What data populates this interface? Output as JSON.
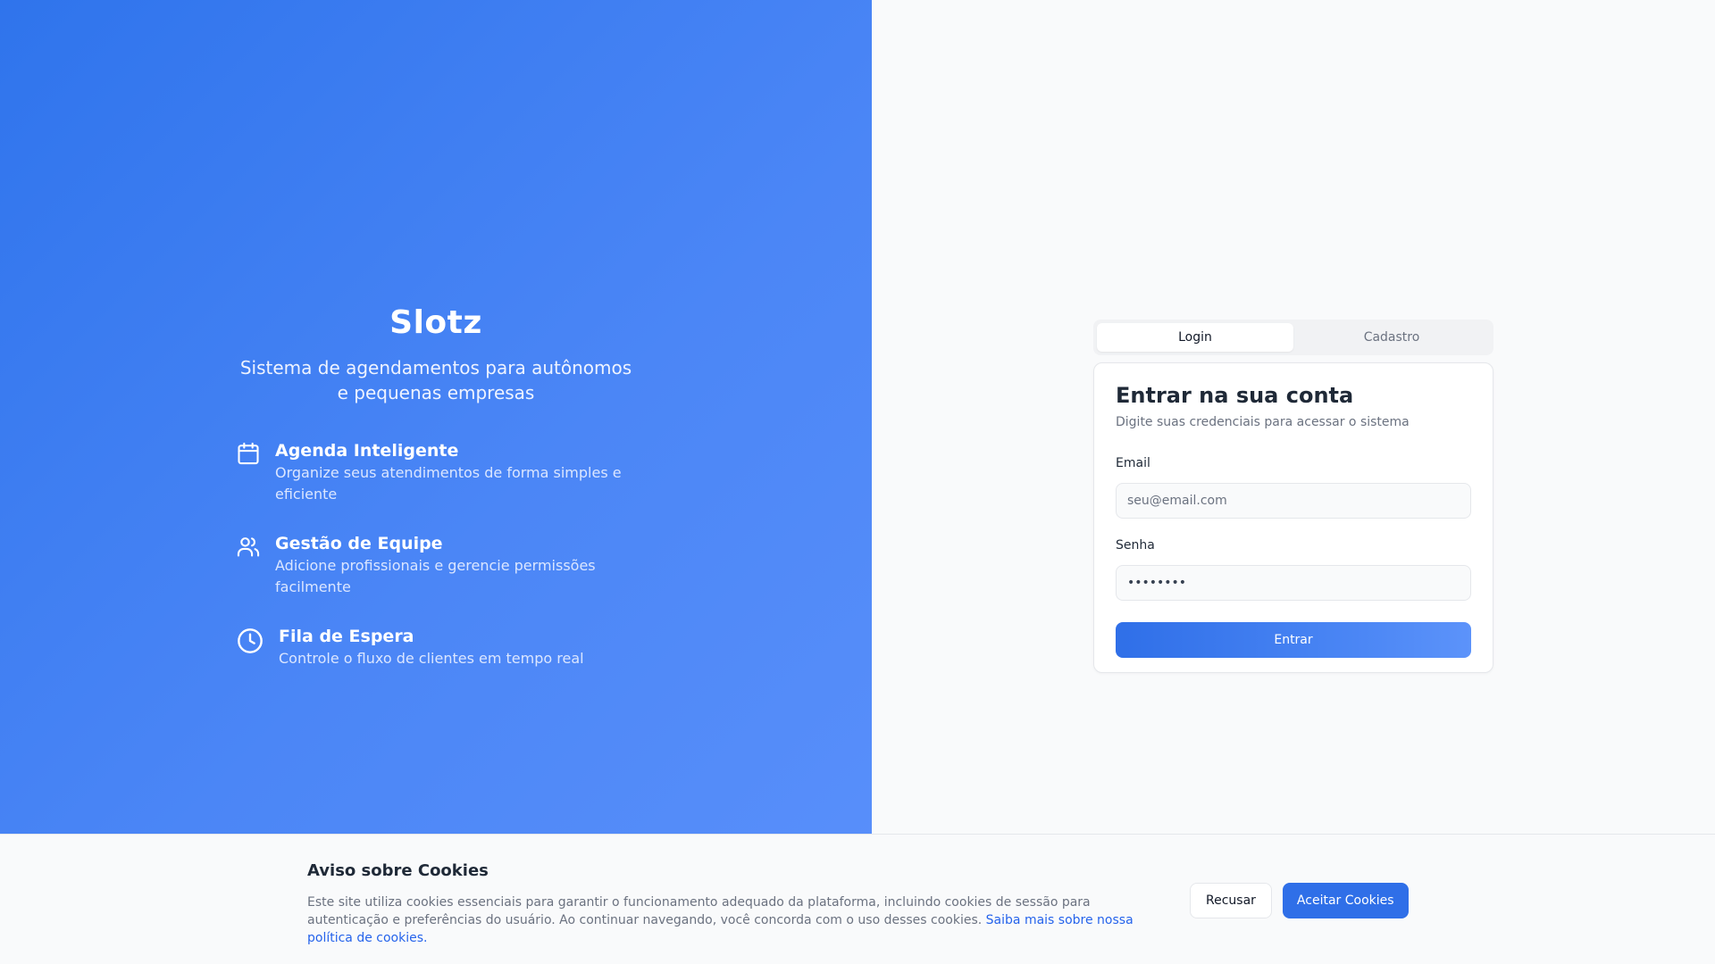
{
  "hero": {
    "brand": "Slotz",
    "tagline": "Sistema de agendamentos para autônomos e pequenas empresas",
    "features": [
      {
        "icon": "calendar-icon",
        "title": "Agenda Inteligente",
        "desc": "Organize seus atendimentos de forma simples e eficiente"
      },
      {
        "icon": "users-icon",
        "title": "Gestão de Equipe",
        "desc": "Adicione profissionais e gerencie permissões facilmente"
      },
      {
        "icon": "clock-icon",
        "title": "Fila de Espera",
        "desc": "Controle o fluxo de clientes em tempo real"
      }
    ]
  },
  "auth": {
    "tabs": [
      {
        "label": "Login",
        "active": true
      },
      {
        "label": "Cadastro",
        "active": false
      }
    ],
    "title": "Entrar na sua conta",
    "subtitle": "Digite suas credenciais para acessar o sistema",
    "email_label": "Email",
    "email_placeholder": "seu@email.com",
    "email_value": "",
    "password_label": "Senha",
    "password_value": "password",
    "submit_label": "Entrar"
  },
  "cookies": {
    "title": "Aviso sobre Cookies",
    "body": "Este site utiliza cookies essenciais para garantir o funcionamento adequado da plataforma, incluindo cookies de sessão para autenticação e preferências do usuário. Ao continuar navegando, você concorda com o uso desses cookies.",
    "link_text": "Saiba mais sobre nossa política de cookies.",
    "decline_label": "Recusar",
    "accept_label": "Aceitar Cookies"
  },
  "colors": {
    "primary": "#2f6fe8",
    "hero_gradient_start": "#2f74ec",
    "hero_gradient_end": "#5a90fb",
    "link": "#2563eb"
  }
}
